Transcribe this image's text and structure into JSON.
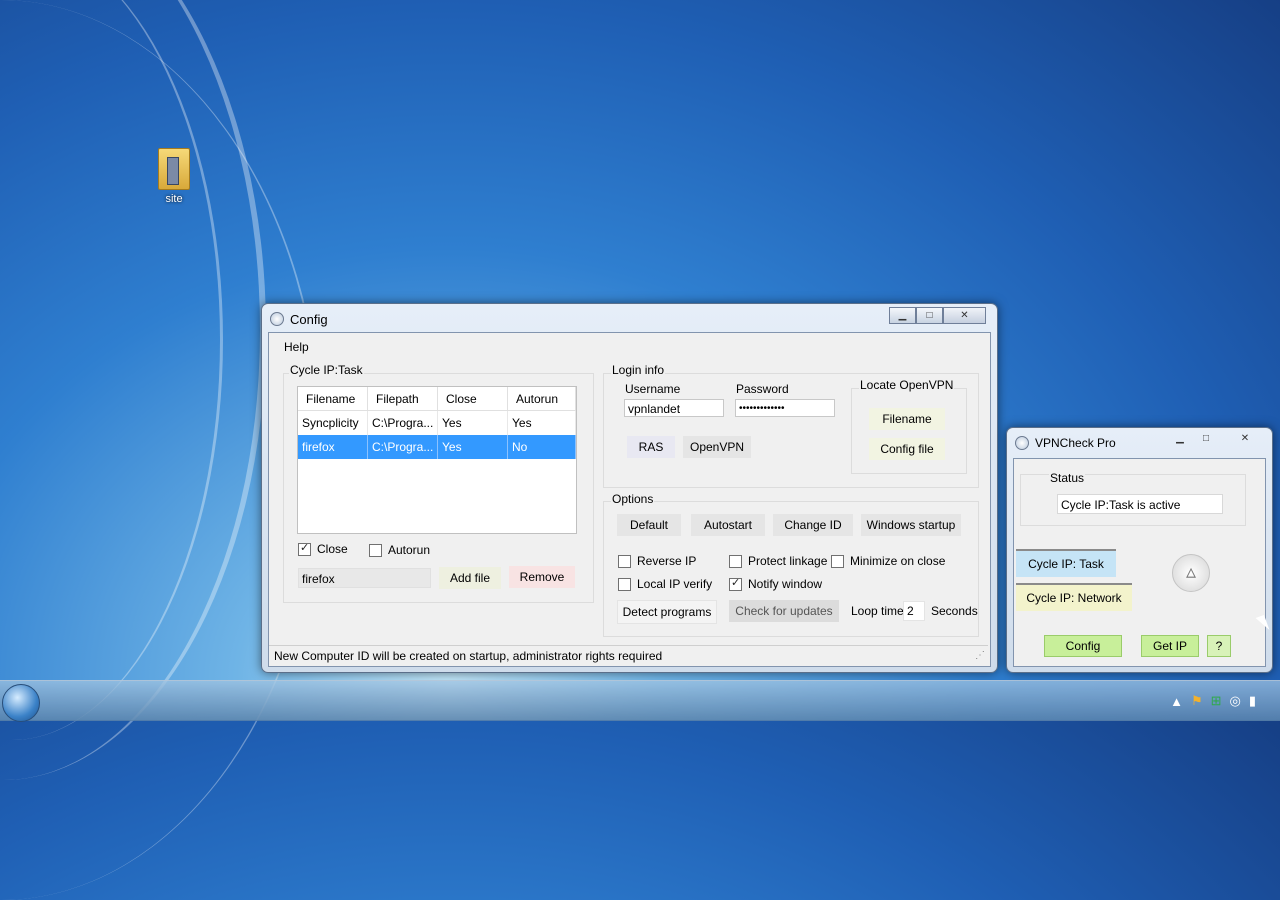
{
  "desktop": {
    "icon_label": "site"
  },
  "config": {
    "title": "Config",
    "menu": [
      "Help"
    ],
    "cycle_group": "Cycle IP:Task",
    "columns": [
      "Filename",
      "Filepath",
      "Close",
      "Autorun"
    ],
    "rows": [
      [
        "Syncplicity",
        "C:\\Progra...",
        "Yes",
        "Yes"
      ],
      [
        "firefox",
        "C:\\Progra...",
        "Yes",
        "No"
      ]
    ],
    "close_label": "Close",
    "autorun_label": "Autorun",
    "file_input": "firefox",
    "add_file": "Add file",
    "remove": "Remove",
    "login_group": "Login info",
    "username_label": "Username",
    "password_label": "Password",
    "username_value": "vpnlandet",
    "password_value": "•••••••••••••",
    "ras": "RAS",
    "openvpn": "OpenVPN",
    "locate_group": "Locate OpenVPN",
    "filename_btn": "Filename",
    "config_file_btn": "Config file",
    "options_group": "Options",
    "default_btn": "Default",
    "autostart_btn": "Autostart",
    "change_id_btn": "Change ID",
    "windows_startup_btn": "Windows startup",
    "reverse_ip": "Reverse IP",
    "protect_linkage": "Protect linkage",
    "minimize_on_close": "Minimize on close",
    "local_ip_verify": "Local IP verify",
    "notify_window": "Notify window",
    "detect_programs": "Detect programs",
    "check_updates": "Check for updates",
    "loop_time": "Loop time",
    "loop_value": "2",
    "seconds": "Seconds",
    "status_bar": "New Computer ID will be created on startup, administrator rights required"
  },
  "vpncheck": {
    "title": "VPNCheck Pro",
    "status_label": "Status",
    "status_value": "Cycle IP:Task is active",
    "cycle_task": "Cycle IP: Task",
    "cycle_network": "Cycle IP: Network",
    "config_btn": "Config",
    "get_ip_btn": "Get IP",
    "help_btn": "?"
  },
  "window_buttons": {
    "minimize": "▁",
    "maximize": "□",
    "close": "✕"
  },
  "icons": [
    "folder-icon",
    "window-icon",
    "start-orb-icon",
    "arrow-icon",
    "flag-icon",
    "network-icon",
    "signal-icon",
    "triangle-logo-icon"
  ]
}
